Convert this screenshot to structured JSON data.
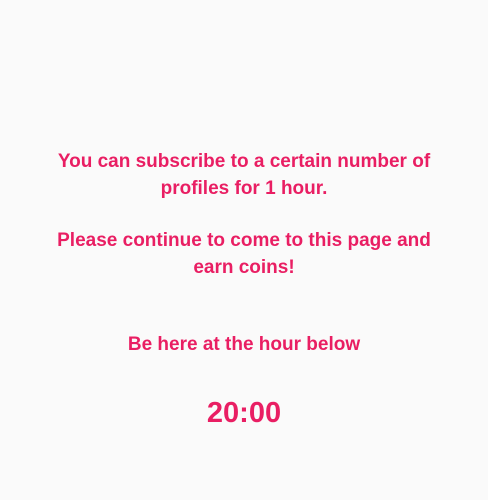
{
  "info": {
    "subscribe_line_1": "You can subscribe to a certain number of",
    "subscribe_line_2": "profiles for 1 hour.",
    "continue_line_1": "Please continue to come to this page and",
    "continue_line_2": "earn coins!",
    "hour_prompt": "Be here at the hour below"
  },
  "timer": {
    "time": "20:00"
  },
  "colors": {
    "accent": "#e91e63",
    "background": "#fafafa"
  }
}
